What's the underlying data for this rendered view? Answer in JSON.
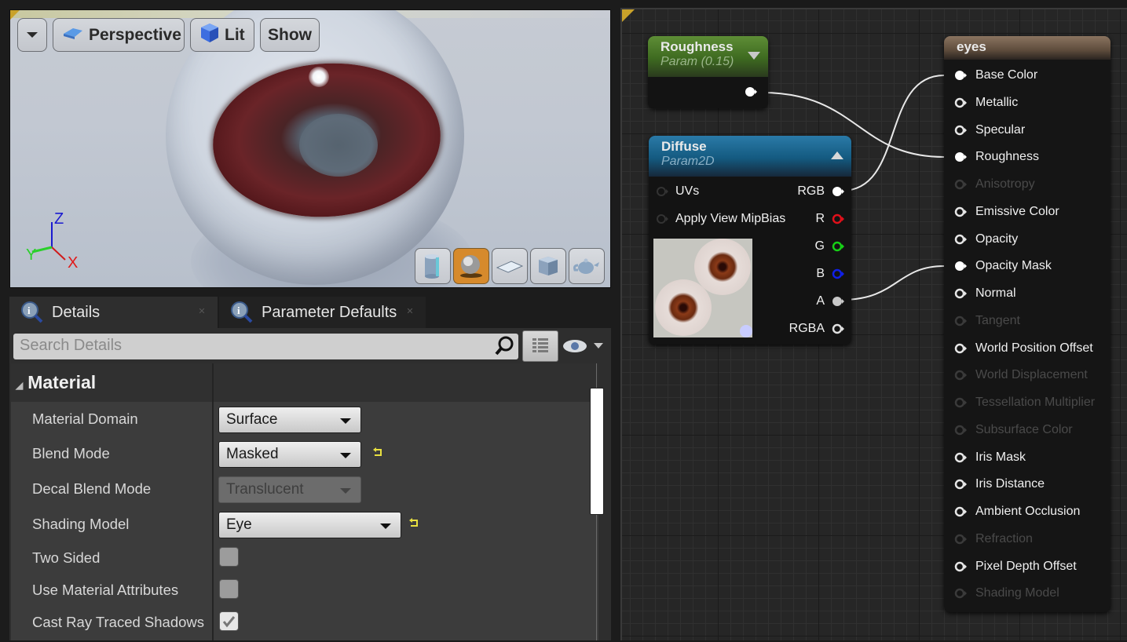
{
  "viewport": {
    "toolbar": {
      "menu_label": "",
      "perspective_label": "Perspective",
      "lit_label": "Lit",
      "show_label": "Show"
    },
    "axes": {
      "x": "X",
      "y": "Y",
      "z": "Z"
    },
    "preview_shapes": [
      {
        "name": "cylinder",
        "active": false
      },
      {
        "name": "sphere",
        "active": true
      },
      {
        "name": "plane",
        "active": false
      },
      {
        "name": "cube",
        "active": false
      },
      {
        "name": "teapot",
        "active": false
      }
    ]
  },
  "tabs": [
    {
      "label": "Details",
      "icon": "info-icon",
      "active": true
    },
    {
      "label": "Parameter Defaults",
      "icon": "info-icon",
      "active": false
    }
  ],
  "details": {
    "search_placeholder": "Search Details",
    "category": "Material",
    "properties": [
      {
        "label": "Material Domain",
        "type": "combo",
        "value": "Surface",
        "reset": false,
        "disabled": false
      },
      {
        "label": "Blend Mode",
        "type": "combo",
        "value": "Masked",
        "reset": true,
        "disabled": false
      },
      {
        "label": "Decal Blend Mode",
        "type": "combo",
        "value": "Translucent",
        "reset": false,
        "disabled": true
      },
      {
        "label": "Shading Model",
        "type": "combo",
        "value": "Eye",
        "reset": true,
        "disabled": false
      },
      {
        "label": "Two Sided",
        "type": "checkbox",
        "checked": false
      },
      {
        "label": "Use Material Attributes",
        "type": "checkbox",
        "checked": false
      },
      {
        "label": "Cast Ray Traced Shadows",
        "type": "checkbox",
        "checked": true
      }
    ]
  },
  "graph": {
    "roughness_node": {
      "title": "Roughness",
      "subtitle": "Param (0.15)"
    },
    "diffuse_node": {
      "title": "Diffuse",
      "subtitle": "Param2D",
      "inputs": [
        "UVs",
        "Apply View MipBias"
      ],
      "outputs": [
        {
          "label": "RGB",
          "color": "#ffffff",
          "connected": true
        },
        {
          "label": "R",
          "color": "#e0101a",
          "connected": false
        },
        {
          "label": "G",
          "color": "#16d016",
          "connected": false
        },
        {
          "label": "B",
          "color": "#1020e8",
          "connected": false
        },
        {
          "label": "A",
          "color": "#c8c8c8",
          "connected": true
        },
        {
          "label": "RGBA",
          "color": "#ffffff",
          "connected": false
        }
      ]
    },
    "result_node": {
      "title": "eyes",
      "inputs": [
        {
          "label": "Base Color",
          "enabled": true,
          "connected": true
        },
        {
          "label": "Metallic",
          "enabled": true,
          "connected": false
        },
        {
          "label": "Specular",
          "enabled": true,
          "connected": false
        },
        {
          "label": "Roughness",
          "enabled": true,
          "connected": true
        },
        {
          "label": "Anisotropy",
          "enabled": false,
          "connected": false
        },
        {
          "label": "Emissive Color",
          "enabled": true,
          "connected": false
        },
        {
          "label": "Opacity",
          "enabled": true,
          "connected": false
        },
        {
          "label": "Opacity Mask",
          "enabled": true,
          "connected": true
        },
        {
          "label": "Normal",
          "enabled": true,
          "connected": false
        },
        {
          "label": "Tangent",
          "enabled": false,
          "connected": false
        },
        {
          "label": "World Position Offset",
          "enabled": true,
          "connected": false
        },
        {
          "label": "World Displacement",
          "enabled": false,
          "connected": false
        },
        {
          "label": "Tessellation Multiplier",
          "enabled": false,
          "connected": false
        },
        {
          "label": "Subsurface Color",
          "enabled": false,
          "connected": false
        },
        {
          "label": "Iris Mask",
          "enabled": true,
          "connected": false
        },
        {
          "label": "Iris Distance",
          "enabled": true,
          "connected": false
        },
        {
          "label": "Ambient Occlusion",
          "enabled": true,
          "connected": false
        },
        {
          "label": "Refraction",
          "enabled": false,
          "connected": false
        },
        {
          "label": "Pixel Depth Offset",
          "enabled": true,
          "connected": false
        },
        {
          "label": "Shading Model",
          "enabled": false,
          "connected": false
        }
      ]
    },
    "colors": {
      "roughness_header": "#4e7a2a",
      "diffuse_header": "#1e5a7e",
      "result_header": "#6e5a46",
      "wire": "#e8e8e8"
    }
  }
}
